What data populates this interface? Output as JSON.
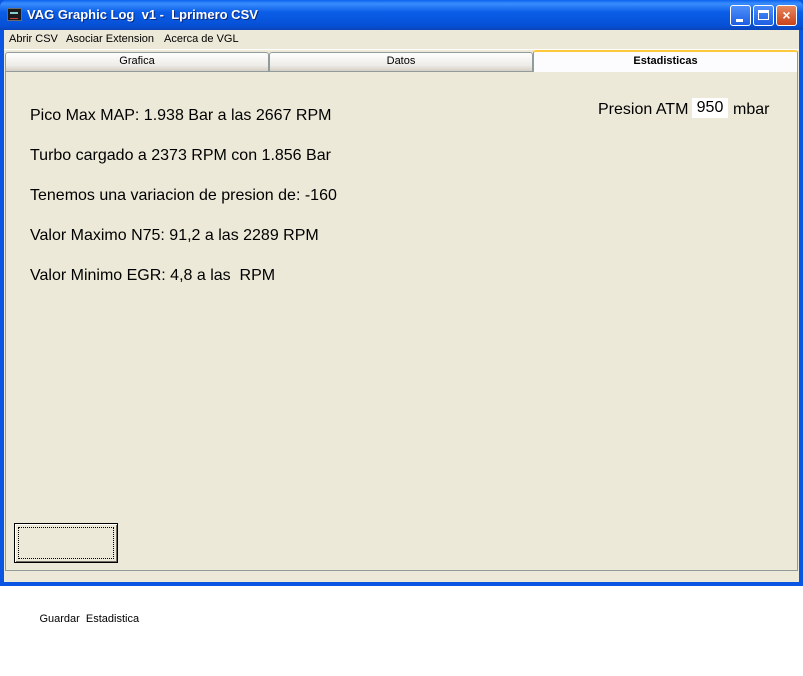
{
  "window": {
    "title": "VAG Graphic Log  v1 -  Lprimero CSV",
    "close_glyph": "×"
  },
  "menu": {
    "items": [
      "Abrir CSV",
      "Asociar Extension",
      "Acerca de VGL"
    ]
  },
  "tabs": [
    {
      "label": "Grafica",
      "active": false
    },
    {
      "label": "Datos",
      "active": false
    },
    {
      "label": "Estadisticas",
      "active": true
    }
  ],
  "stats": {
    "lines": [
      "Pico Max MAP: 1.938 Bar a las 2667 RPM",
      "Turbo cargado a 2373 RPM con 1.856 Bar",
      "Tenemos una variacion de presion de: -160",
      "Valor Maximo N75: 91,2 a las 2289 RPM",
      "Valor Minimo EGR: 4,8 a las  RPM"
    ]
  },
  "atm": {
    "label": "Presion ATM",
    "value": "950",
    "unit": "mbar"
  },
  "buttons": {
    "save_label": "Guardar  Estadistica"
  },
  "icons": {
    "app": "app-chart-icon",
    "minimize": "minimize-icon",
    "maximize": "maximize-icon",
    "close": "close-icon"
  },
  "colors": {
    "titlebar": "#0a56e2",
    "panel": "#ece9d8",
    "active_tab_accent": "#ffc73c"
  }
}
